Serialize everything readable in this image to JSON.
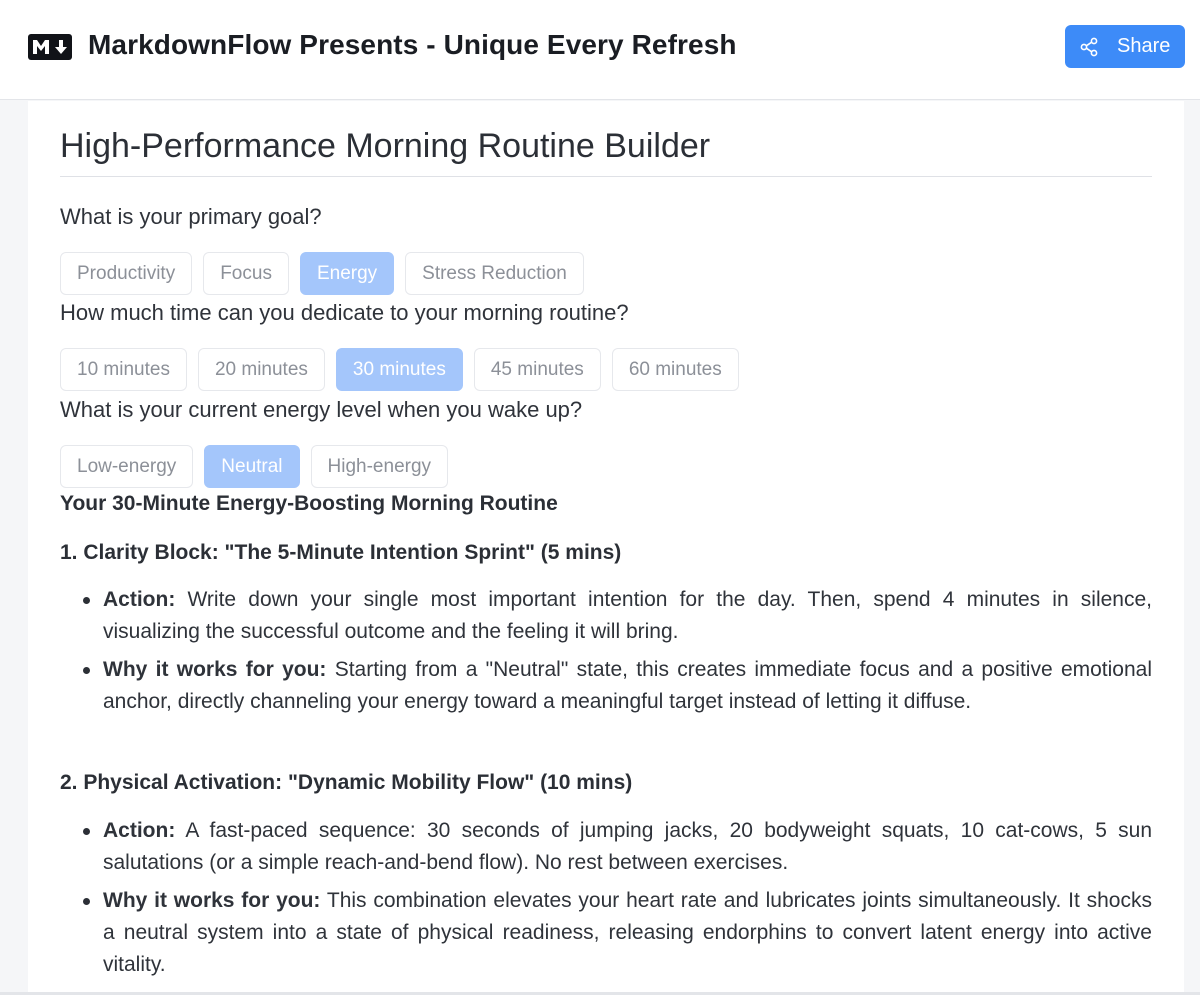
{
  "header": {
    "logo_text": "M↓",
    "app_title": "MarkdownFlow Presents - Unique Every Refresh",
    "share_label": "Share",
    "share_icon": "share-icon",
    "accent": "#3d8bf8"
  },
  "doc": {
    "title": "High-Performance Morning Routine Builder",
    "questions": [
      {
        "label": "What is your primary goal?",
        "options": [
          "Productivity",
          "Focus",
          "Energy",
          "Stress Reduction"
        ],
        "selected": "Energy"
      },
      {
        "label": "How much time can you dedicate to your morning routine?",
        "options": [
          "10 minutes",
          "20 minutes",
          "30 minutes",
          "45 minutes",
          "60 minutes"
        ],
        "selected": "30 minutes"
      },
      {
        "label": "What is your current energy level when you wake up?",
        "options": [
          "Low-energy",
          "Neutral",
          "High-energy"
        ],
        "selected": "Neutral"
      }
    ],
    "routine_heading": "Your 30-Minute Energy-Boosting Morning Routine",
    "sections": [
      {
        "heading": "1. Clarity Block: \"The 5-Minute Intention Sprint\" (5 mins)",
        "bullets": [
          {
            "label": "Action:",
            "text": " Write down your single most important intention for the day. Then, spend 4 minutes in silence, visualizing the successful outcome and the feeling it will bring."
          },
          {
            "label": "Why it works for you:",
            "text": " Starting from a \"Neutral\" state, this creates immediate focus and a positive emotional anchor, directly channeling your energy toward a meaningful target instead of letting it diffuse."
          }
        ]
      },
      {
        "heading": "2. Physical Activation: \"Dynamic Mobility Flow\" (10 mins)",
        "bullets": [
          {
            "label": "Action:",
            "text": " A fast-paced sequence: 30 seconds of jumping jacks, 20 bodyweight squats, 10 cat-cows, 5 sun salutations (or a simple reach-and-bend flow). No rest between exercises."
          },
          {
            "label": "Why it works for you:",
            "text": " This combination elevates your heart rate and lubricates joints simultaneously. It shocks a neutral system into a state of physical readiness, releasing endorphins to convert latent energy into active vitality."
          }
        ]
      }
    ]
  }
}
